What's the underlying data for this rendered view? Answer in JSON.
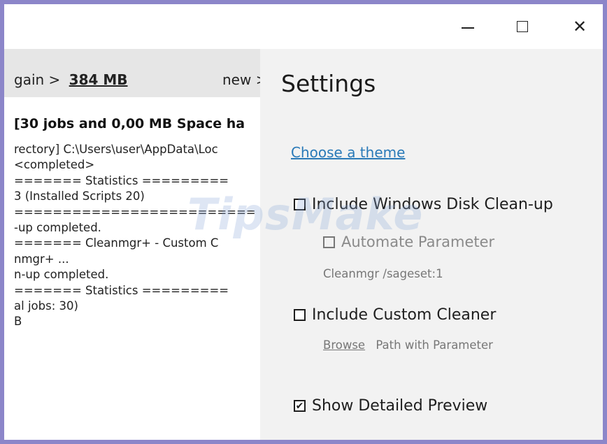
{
  "window": {
    "minimize_glyph": "",
    "maximize_glyph": "",
    "close_glyph": "✕"
  },
  "log_panel": {
    "summary_prefix": "gain >",
    "summary_size": "384 MB",
    "summary_new": "new >",
    "title": "[30 jobs and 0,00 MB Space ha",
    "lines": [
      "rectory] C:\\Users\\user\\AppData\\Loc",
      " <completed>",
      "======= Statistics =========",
      " 3 (Installed Scripts 20)",
      "=========================",
      "-up completed.",
      "======= Cleanmgr+ - Custom C",
      "nmgr+ ...",
      "n-up completed.",
      "======= Statistics =========",
      "al jobs: 30)",
      "B"
    ]
  },
  "settings": {
    "title": "Settings",
    "theme_link": "Choose a theme",
    "options": {
      "disk_cleanup": {
        "label": "Include Windows Disk Clean-up",
        "checked": false
      },
      "automate": {
        "label": "Automate Parameter",
        "checked": false,
        "enabled": false
      },
      "automate_hint": "Cleanmgr /sageset:1",
      "custom_cleaner": {
        "label": "Include Custom Cleaner",
        "checked": false
      },
      "browse_label": "Browse",
      "path_hint": "Path with Parameter",
      "detailed_preview": {
        "label": "Show Detailed Preview",
        "checked": true,
        "mark": "✔"
      }
    }
  },
  "watermark": "TipsMake",
  "icons": {
    "minimize": "minimize-icon",
    "maximize": "maximize-icon",
    "close": "close-icon",
    "checkbox": "checkbox-icon",
    "checkmark": "checkmark-icon"
  },
  "colors": {
    "frame": "#8c86c9",
    "link": "#2a7ab8",
    "settings_bg": "#f2f2f2",
    "log_header_bg": "#e6e6e6"
  }
}
